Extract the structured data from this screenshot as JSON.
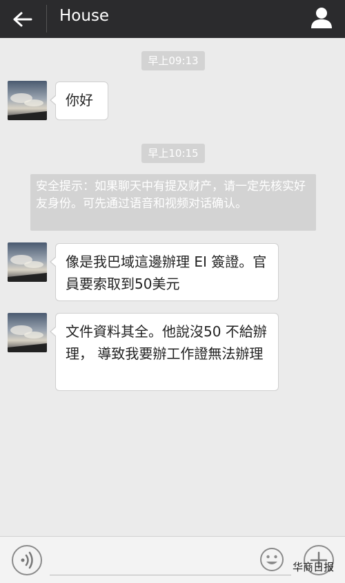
{
  "header": {
    "title": "House"
  },
  "messages": {
    "ts1": "早上09:13",
    "m1": "你好",
    "ts2": "早上10:15",
    "notice": "安全提示：如果聊天中有提及财产，请一定先核实好友身份。可先通过语音和视频对话确认。",
    "m2": "像是我巴域這邊辦理 EI 簽證。官員要索取到50美元",
    "m3": "文件資料其全。他說沒50 不給辦理， 導致我要辦工作證無法辦理"
  },
  "input": {
    "value": ""
  },
  "icons": {
    "back": "back-arrow-icon",
    "profile": "person-icon",
    "voice": "voice-icon",
    "emoji": "smiley-icon",
    "plus": "plus-icon"
  },
  "watermark": "华商日报",
  "colors": {
    "header": "#2b2b2d",
    "background": "#ebebeb",
    "timestamp": "#d3d3d3"
  }
}
